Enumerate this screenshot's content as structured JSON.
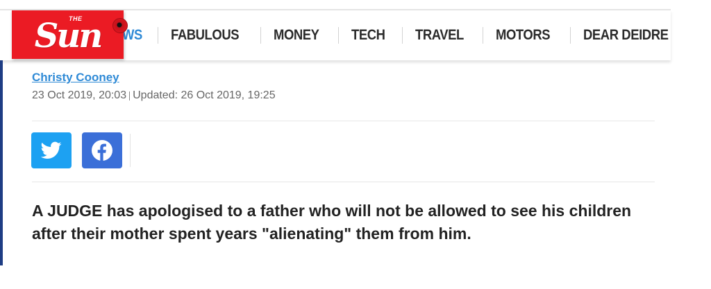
{
  "header": {
    "logo_the": "THE",
    "logo_sun": "Sun",
    "nav": [
      {
        "label": "WS",
        "active": true
      },
      {
        "label": "FABULOUS",
        "active": false
      },
      {
        "label": "MONEY",
        "active": false
      },
      {
        "label": "TECH",
        "active": false
      },
      {
        "label": "TRAVEL",
        "active": false
      },
      {
        "label": "MOTORS",
        "active": false
      },
      {
        "label": "DEAR DEIDRE",
        "active": false
      }
    ]
  },
  "article": {
    "author": "Christy Cooney",
    "published": "23 Oct 2019, 20:03",
    "updated": "Updated: 26 Oct 2019, 19:25",
    "lede": "A JUDGE has apologised to a father who will not be allowed to see his children after their mother spent years \"alienating\" them from him."
  },
  "share": {
    "twitter_icon": "twitter-bird-icon",
    "facebook_icon": "facebook-f-icon"
  },
  "colors": {
    "brand_red": "#eb1b24",
    "link_blue": "#2f8ad6",
    "twitter": "#1da1f2",
    "facebook": "#3b6fd8",
    "side_bar": "#1e3d84"
  }
}
